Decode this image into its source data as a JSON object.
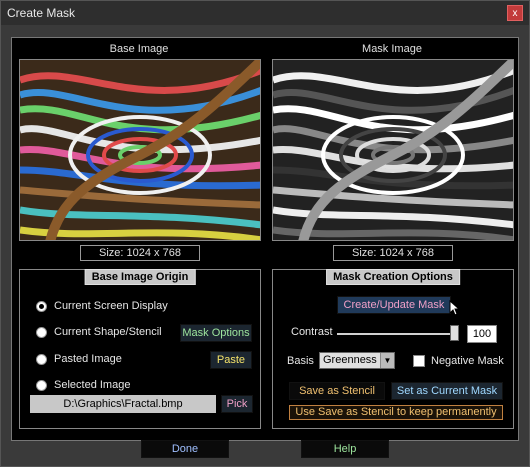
{
  "window": {
    "title": "Create Mask",
    "close_label": "x"
  },
  "base_image": {
    "label": "Base Image",
    "size": "Size:  1024 x 768"
  },
  "mask_image": {
    "label": "Mask Image",
    "size": "Size:  1024 x 768"
  },
  "origin": {
    "title": "Base Image Origin",
    "options": [
      {
        "label": "Current Screen Display",
        "selected": true
      },
      {
        "label": "Current Shape/Stencil",
        "selected": false
      },
      {
        "label": "Pasted Image",
        "selected": false
      },
      {
        "label": "Selected Image",
        "selected": false
      }
    ],
    "mask_options_label": "Mask Options",
    "paste_label": "Paste",
    "path": "D:\\Graphics\\Fractal.bmp",
    "pick_label": "Pick"
  },
  "mask_options": {
    "title": "Mask Creation Options",
    "create_label": "Create/Update Mask",
    "contrast_label": "Contrast",
    "contrast_value": "100",
    "contrast_fraction": 1.0,
    "basis_label": "Basis",
    "basis_value": "Greenness",
    "negative_label": "Negative Mask",
    "negative_checked": false,
    "save_stencil_label": "Save as Stencil",
    "set_mask_label": "Set as Current Mask",
    "hint": "Use Save as Stencil to keep permanently"
  },
  "footer": {
    "done_label": "Done",
    "help_label": "Help"
  }
}
